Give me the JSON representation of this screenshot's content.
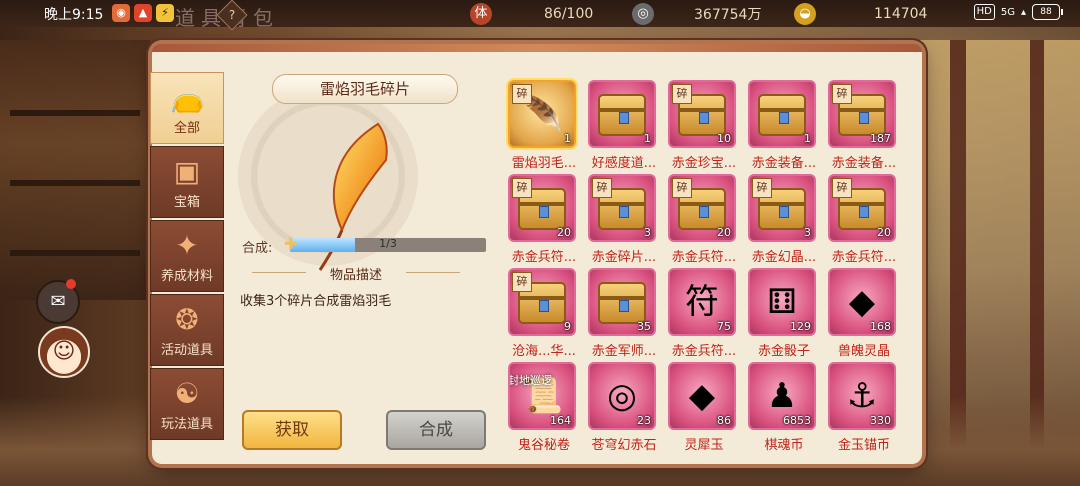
{
  "status_bar": {
    "time": "晚上9:15",
    "battery": "88",
    "network": "HD",
    "signal": "5G"
  },
  "header": {
    "title_faint": "道具背包",
    "help_icon_text": "?",
    "stamina": {
      "icon_char": "体",
      "value": "86/100"
    },
    "coins": {
      "value": "367754万"
    },
    "ingots": {
      "value": "114704"
    }
  },
  "tabs": [
    {
      "label": "全部",
      "icon": "money-bag-icon",
      "active": true
    },
    {
      "label": "宝箱",
      "icon": "treasure-chest-icon",
      "active": false
    },
    {
      "label": "养成材料",
      "icon": "crystal-icon",
      "active": false
    },
    {
      "label": "活动道具",
      "icon": "gourd-icon",
      "active": false
    },
    {
      "label": "玩法道具",
      "icon": "yin-yang-icon",
      "active": false
    }
  ],
  "detail": {
    "item_name": "雷焰羽毛碎片",
    "compose_label": "合成:",
    "progress_text": "1/3",
    "progress_fraction": 0.333,
    "desc_title": "物品描述",
    "desc_text": "收集3个碎片合成雷焰羽毛",
    "get_button": "获取",
    "compose_button": "合成"
  },
  "items": [
    {
      "label": "雷焰羽毛...",
      "count": "1",
      "frag": "碎",
      "art": "feather-icon",
      "glyph": "🪶",
      "selected": true
    },
    {
      "label": "好感度道...",
      "count": "1",
      "frag": "",
      "art": "treasure-chest-icon",
      "glyph": ""
    },
    {
      "label": "赤金珍宝...",
      "count": "10",
      "frag": "碎",
      "art": "treasure-chest-icon",
      "glyph": ""
    },
    {
      "label": "赤金装备...",
      "count": "1",
      "frag": "",
      "art": "treasure-chest-icon",
      "glyph": ""
    },
    {
      "label": "赤金装备...",
      "count": "187",
      "frag": "碎",
      "art": "treasure-chest-icon",
      "glyph": ""
    },
    {
      "label": "赤金兵符...",
      "count": "20",
      "frag": "碎",
      "art": "treasure-chest-icon",
      "glyph": ""
    },
    {
      "label": "赤金碎片...",
      "count": "3",
      "frag": "碎",
      "art": "treasure-chest-icon",
      "glyph": ""
    },
    {
      "label": "赤金兵符...",
      "count": "20",
      "frag": "碎",
      "art": "treasure-chest-icon",
      "glyph": ""
    },
    {
      "label": "赤金幻晶...",
      "count": "3",
      "frag": "碎",
      "art": "treasure-chest-icon",
      "glyph": ""
    },
    {
      "label": "赤金兵符...",
      "count": "20",
      "frag": "碎",
      "art": "treasure-chest-icon",
      "glyph": ""
    },
    {
      "label": "沧海...华...",
      "count": "9",
      "frag": "碎",
      "art": "treasure-chest-icon",
      "glyph": ""
    },
    {
      "label": "赤金军师...",
      "count": "35",
      "frag": "",
      "art": "treasure-chest-icon",
      "glyph": ""
    },
    {
      "label": "赤金兵符...",
      "count": "75",
      "frag": "",
      "art": "tally-card-icon",
      "glyph": "符"
    },
    {
      "label": "赤金骰子",
      "count": "129",
      "frag": "",
      "art": "dice-icon",
      "glyph": "⚅"
    },
    {
      "label": "兽魄灵晶",
      "count": "168",
      "frag": "",
      "art": "red-crystal-icon",
      "glyph": "◆"
    },
    {
      "label": "鬼谷秘卷",
      "count": "164",
      "frag": "",
      "art": "scroll-icon",
      "glyph": "📜",
      "overlay": "封地巡逻"
    },
    {
      "label": "苍穹幻赤石",
      "count": "23",
      "frag": "",
      "art": "ring-stone-icon",
      "glyph": "◎"
    },
    {
      "label": "灵犀玉",
      "count": "86",
      "frag": "",
      "art": "jade-icon",
      "glyph": "◆"
    },
    {
      "label": "棋魂币",
      "count": "6853",
      "frag": "",
      "art": "chess-coin-icon",
      "glyph": "♟"
    },
    {
      "label": "金玉锚币",
      "count": "330",
      "frag": "",
      "art": "anchor-coin-icon",
      "glyph": "⚓"
    }
  ]
}
